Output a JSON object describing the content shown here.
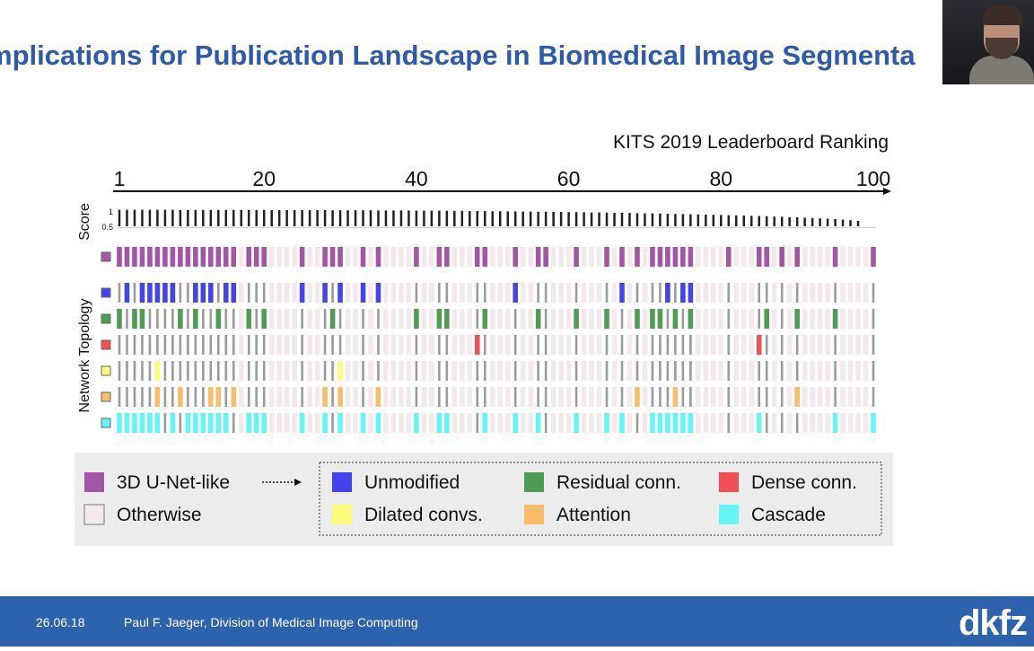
{
  "slide": {
    "title": "mplications for Publication Landscape in Biomedical Image Segmenta"
  },
  "footer": {
    "date": "26.06.18",
    "author": "Paul F. Jaeger, Division of Medical Image Computing",
    "logo": "dkfz"
  },
  "colors": {
    "title": "#2f5aa8",
    "footer_bg": "#2d62ad",
    "unet": "#a356a5",
    "otherwise": "#f3e9ea",
    "unmodified": "#4444ee",
    "residual": "#4f9d55",
    "dense": "#ef4f55",
    "dilated": "#fbfb7d",
    "attention": "#f8bc6a",
    "cascade": "#63f6f4",
    "empty_bar": "#9b9b9b",
    "score_bar": "#222222"
  },
  "chart_data": {
    "type": "heatmap",
    "title": "KITS 2019 Leaderboard Ranking",
    "x_ticks": [
      "1",
      "20",
      "40",
      "60",
      "80",
      "100"
    ],
    "x_range": [
      1,
      100
    ],
    "score_label": "Score",
    "score_ticks": [
      "1",
      "0.5"
    ],
    "topology_label": "Network Topology",
    "n_submissions": 100,
    "scores": [
      0.92,
      0.92,
      0.92,
      0.92,
      0.92,
      0.92,
      0.92,
      0.92,
      0.91,
      0.91,
      0.91,
      0.91,
      0.91,
      0.91,
      0.91,
      0.91,
      0.91,
      0.91,
      0.91,
      0.91,
      0.9,
      0.9,
      0.9,
      0.9,
      0.9,
      0.9,
      0.9,
      0.9,
      0.89,
      0.89,
      0.89,
      0.89,
      0.89,
      0.89,
      0.88,
      0.88,
      0.88,
      0.88,
      0.88,
      0.87,
      0.87,
      0.87,
      0.87,
      0.86,
      0.86,
      0.86,
      0.85,
      0.85,
      0.85,
      0.84,
      0.84,
      0.83,
      0.83,
      0.82,
      0.82,
      0.81,
      0.81,
      0.8,
      0.8,
      0.79,
      0.79,
      0.78,
      0.77,
      0.77,
      0.76,
      0.75,
      0.75,
      0.74,
      0.73,
      0.72,
      0.72,
      0.71,
      0.7,
      0.69,
      0.68,
      0.67,
      0.66,
      0.65,
      0.64,
      0.63,
      0.62,
      0.61,
      0.6,
      0.58,
      0.57,
      0.56,
      0.54,
      0.53,
      0.51,
      0.5,
      0.48,
      0.46,
      0.44,
      0.42,
      0.4,
      0.37,
      0.34,
      0.3,
      0,
      0
    ],
    "rows": [
      {
        "key": "unet",
        "name": "3D U-Net-like",
        "ranks": [
          1,
          2,
          3,
          4,
          5,
          6,
          7,
          8,
          9,
          10,
          11,
          12,
          13,
          14,
          15,
          16,
          18,
          19,
          20,
          25,
          28,
          29,
          30,
          33,
          35,
          40,
          43,
          44,
          48,
          49,
          53,
          56,
          57,
          61,
          65,
          67,
          69,
          71,
          72,
          73,
          74,
          75,
          76,
          81,
          85,
          86,
          88,
          90,
          95,
          100
        ]
      },
      {
        "key": "unmodified",
        "name": "Unmodified",
        "ranks": [
          2,
          4,
          5,
          6,
          7,
          8,
          11,
          12,
          13,
          15,
          16,
          25,
          28,
          30,
          33,
          35,
          53,
          67,
          73,
          75,
          76
        ]
      },
      {
        "key": "residual",
        "name": "Residual conn.",
        "ranks": [
          1,
          3,
          4,
          9,
          11,
          14,
          18,
          20,
          29,
          40,
          43,
          44,
          49,
          56,
          61,
          65,
          69,
          71,
          72,
          74,
          76,
          86,
          90,
          95
        ]
      },
      {
        "key": "dense",
        "name": "Dense conn.",
        "ranks": [
          48,
          85
        ]
      },
      {
        "key": "dilated",
        "name": "Dilated convs.",
        "ranks": [
          6,
          30
        ]
      },
      {
        "key": "attention",
        "name": "Attention",
        "ranks": [
          6,
          9,
          13,
          14,
          16,
          28,
          30,
          35,
          69,
          74,
          90
        ]
      },
      {
        "key": "cascade",
        "name": "Cascade",
        "ranks": [
          1,
          2,
          3,
          4,
          5,
          6,
          8,
          10,
          11,
          12,
          13,
          14,
          15,
          18,
          19,
          20,
          25,
          28,
          30,
          33,
          35,
          40,
          43,
          44,
          49,
          53,
          56,
          61,
          65,
          67,
          71,
          72,
          73,
          74,
          75,
          76,
          85,
          95,
          100
        ]
      }
    ],
    "legend": [
      {
        "key": "unet",
        "label": "3D U-Net-like"
      },
      {
        "key": "otherwise",
        "label": "Otherwise"
      },
      {
        "key": "unmodified",
        "label": "Unmodified"
      },
      {
        "key": "residual",
        "label": "Residual conn."
      },
      {
        "key": "dense",
        "label": "Dense conn."
      },
      {
        "key": "dilated",
        "label": "Dilated convs."
      },
      {
        "key": "attention",
        "label": "Attention"
      },
      {
        "key": "cascade",
        "label": "Cascade"
      }
    ]
  }
}
